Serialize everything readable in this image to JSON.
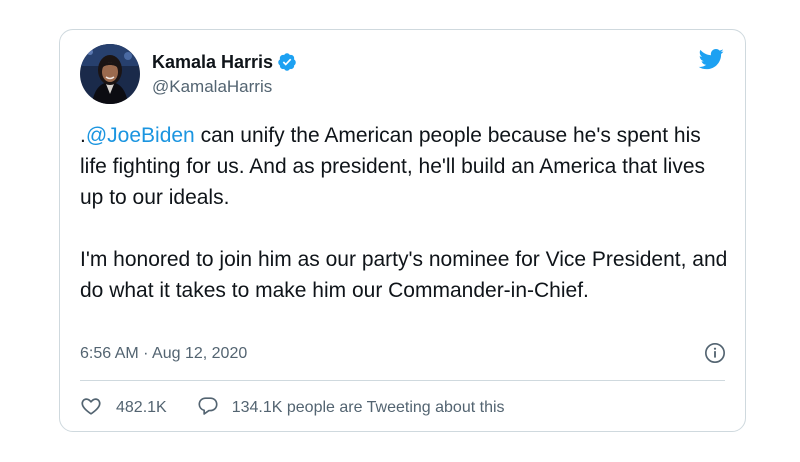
{
  "tweet": {
    "author": {
      "display_name": "Kamala Harris",
      "handle": "@KamalaHarris",
      "verified": true,
      "avatar": "profile-photo"
    },
    "text": {
      "lead_char": ".",
      "mention": "@JoeBiden",
      "paragraph1_rest": " can unify the American people because he's spent his life fighting for us. And as president, he'll build an America that lives up to our ideals.",
      "paragraph2": "I'm honored to join him as our party's nominee for Vice President, and do what it takes to make him our Commander-in-Chief."
    },
    "timestamp": "6:56 AM · Aug 12, 2020",
    "likes": "482.1K",
    "replies_text": "134.1K people are Tweeting about this"
  },
  "icons": {
    "brand": "twitter-bird-icon",
    "verified": "verified-badge-icon",
    "info": "info-icon",
    "like": "heart-icon",
    "reply": "speech-bubble-icon"
  },
  "colors": {
    "brand_blue": "#1da1f2",
    "link_blue": "#1b95e0",
    "text_primary": "#0f1419",
    "text_secondary": "#536471",
    "border": "#cfd9de"
  }
}
